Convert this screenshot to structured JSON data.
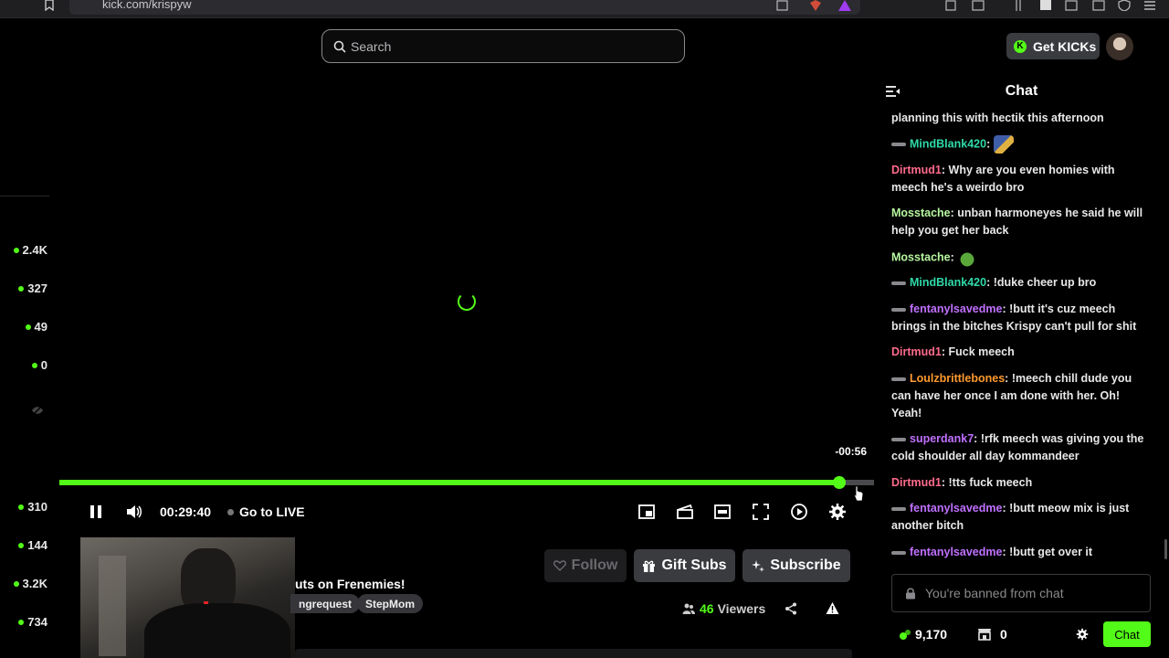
{
  "browser": {
    "url": "kick.com/krispyw"
  },
  "header": {
    "search": {
      "placeholder": "Search"
    },
    "get_kicks_label": "Get KICKs"
  },
  "sidebar": {
    "top_counts": [
      "2.4K",
      "327",
      "49",
      "0"
    ],
    "bottom_counts": [
      "310",
      "144",
      "3.2K",
      "734"
    ]
  },
  "player": {
    "time_remaining": "-00:56",
    "elapsed": "00:29:40",
    "go_live_label": "Go to LIVE",
    "progress_fraction": 0.957,
    "accent": "#53fc18"
  },
  "stream": {
    "title": "uts on Frenemies!",
    "tags": [
      "ngrequest",
      "StepMom"
    ],
    "follow_label": "Follow",
    "gift_label": "Gift Subs",
    "subscribe_label": "Subscribe",
    "viewer_count": "46",
    "viewers_label": "Viewers"
  },
  "chat": {
    "title": "Chat",
    "messages": [
      {
        "user": "",
        "color": "#e8e8ea",
        "text": "planning this with hectik this afternoon",
        "badge": false,
        "emote": false
      },
      {
        "user": "MindBlank420",
        "color": "#2fd8a8",
        "text": "",
        "badge": true,
        "emote": true
      },
      {
        "user": "Dirtmud1",
        "color": "#ff6b8b",
        "text": "Why are you even homies with meech he's a weirdo bro",
        "badge": false,
        "emote": false
      },
      {
        "user": "Mosstache",
        "color": "#b7f7a0",
        "text": "unban harmoneyes he said he will help you get her back",
        "badge": false,
        "emote": false
      },
      {
        "user": "Mosstache",
        "color": "#b7f7a0",
        "text": "",
        "badge": false,
        "emote": true
      },
      {
        "user": "MindBlank420",
        "color": "#2fd8a8",
        "text": "!duke cheer up bro",
        "badge": true,
        "emote": false
      },
      {
        "user": "fentanylsavedme",
        "color": "#c070ff",
        "text": "!butt it's cuz meech brings in the bitches Krispy can't pull for shit",
        "badge": true,
        "emote": false
      },
      {
        "user": "Dirtmud1",
        "color": "#ff6b8b",
        "text": "Fuck meech",
        "badge": false,
        "emote": false
      },
      {
        "user": "Loulzbrittlebones",
        "color": "#ff9a2e",
        "text": "!meech chill dude you can have her once I am done with her. Oh! Yeah!",
        "badge": true,
        "emote": false
      },
      {
        "user": "superdank7",
        "color": "#c070ff",
        "text": "!rfk meech was giving you the cold shoulder all day kommandeer",
        "badge": true,
        "emote": false
      },
      {
        "user": "Dirtmud1",
        "color": "#ff6b8b",
        "text": "!tts fuck meech",
        "badge": false,
        "emote": false
      },
      {
        "user": "fentanylsavedme",
        "color": "#c070ff",
        "text": "!butt meow mix is just another bitch",
        "badge": true,
        "emote": false
      },
      {
        "user": "fentanylsavedme",
        "color": "#c070ff",
        "text": "!butt get over it",
        "badge": true,
        "emote": false
      }
    ],
    "banned_placeholder": "You're banned from chat",
    "points": "9,170",
    "store_count": "0",
    "send_label": "Chat"
  }
}
